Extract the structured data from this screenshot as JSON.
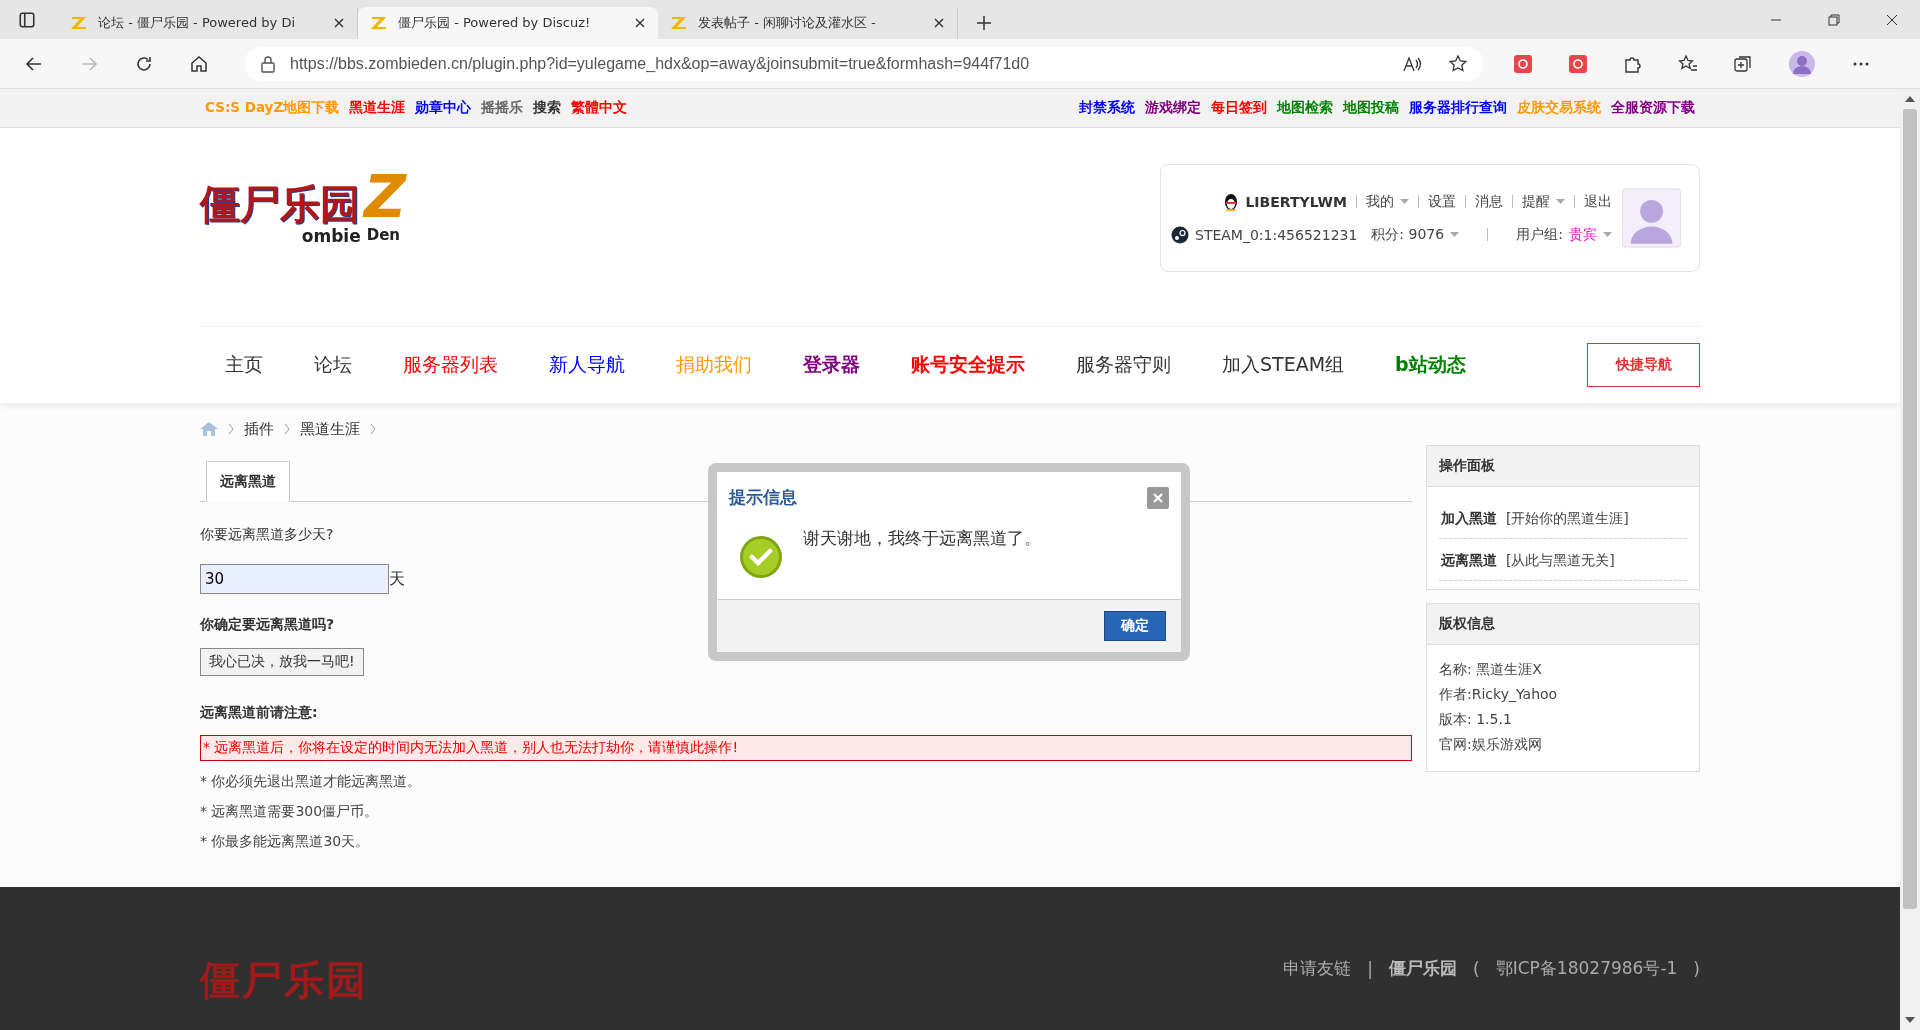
{
  "browser": {
    "tabs": [
      {
        "title": "论坛 - 僵尸乐园 - Powered by Di",
        "selected": false
      },
      {
        "title": "僵尸乐园 - Powered by Discuz!",
        "selected": true
      },
      {
        "title": "发表帖子 - 闲聊讨论及灌水区 -",
        "selected": false
      }
    ],
    "url": "https://bbs.zombieden.cn/plugin.php?id=yulegame_hdx&op=away&joinsubmit=true&formhash=944f71d0"
  },
  "top_links_left": [
    {
      "label": "CS:S DayZ地图下载",
      "color": "#ff9900"
    },
    {
      "label": "黑道生涯",
      "color": "#ff0000"
    },
    {
      "label": "勋章中心",
      "color": "#0000ff"
    },
    {
      "label": "摇摇乐",
      "color": "#666666"
    },
    {
      "label": "搜索",
      "color": "#333333"
    },
    {
      "label": "繁體中文",
      "color": "#ff0000"
    }
  ],
  "top_links_right": [
    {
      "label": "封禁系统",
      "color": "#0000ff"
    },
    {
      "label": "游戏绑定",
      "color": "#800080"
    },
    {
      "label": "每日签到",
      "color": "#ff0000"
    },
    {
      "label": "地图检索",
      "color": "#008000"
    },
    {
      "label": "地图投稿",
      "color": "#008000"
    },
    {
      "label": "服务器排行查询",
      "color": "#0000ff"
    },
    {
      "label": "皮肤交易系统",
      "color": "#ff9900"
    },
    {
      "label": "全服资源下载",
      "color": "#800080"
    }
  ],
  "logo": {
    "title": "僵尸乐园",
    "mark": "Z",
    "line_1": "ombie",
    "line_2": "Den"
  },
  "user": {
    "name": "LIBERTYLWM",
    "links": [
      {
        "label": "我的",
        "menu": true
      },
      {
        "label": "设置",
        "menu": false
      },
      {
        "label": "消息",
        "menu": false
      },
      {
        "label": "提醒",
        "menu": true
      },
      {
        "label": "退出",
        "menu": false
      }
    ],
    "steam_id": "STEAM_0:1:456521231",
    "points": "积分: 9076",
    "group_label": "用户组:",
    "group": "贵宾"
  },
  "nav": [
    {
      "label": "主页",
      "color": "#333333",
      "bold": false
    },
    {
      "label": "论坛",
      "color": "#333333",
      "bold": false
    },
    {
      "label": "服务器列表",
      "color": "#ff0000",
      "bold": false
    },
    {
      "label": "新人导航",
      "color": "#0000ff",
      "bold": false
    },
    {
      "label": "捐助我们",
      "color": "#ff9900",
      "bold": false
    },
    {
      "label": "登录器",
      "color": "#800080",
      "bold": true
    },
    {
      "label": "账号安全提示",
      "color": "#ff0000",
      "bold": true
    },
    {
      "label": "服务器守则",
      "color": "#333333",
      "bold": false
    },
    {
      "label": "加入STEAM组",
      "color": "#333333",
      "bold": false
    },
    {
      "label": "b站动态",
      "color": "#008000",
      "bold": true
    }
  ],
  "quick_nav": "快捷导航",
  "breadcrumb": [
    "插件",
    "黑道生涯"
  ],
  "content_tabs": [
    {
      "label": "远离黑道",
      "selected": true
    }
  ],
  "form": {
    "question": "你要远离黑道多少天?",
    "days": "30",
    "unit": "天",
    "confirm_question": "你确定要远离黑道吗?",
    "submit": "我心已决，放我一马吧!",
    "notice_title": "远离黑道前请注意:",
    "warning": "* 远离黑道后，你将在设定的时间内无法加入黑道，别人也无法打劫你，请谨慎此操作!",
    "notes": [
      "* 你必须先退出黑道才能远离黑道。",
      "* 远离黑道需要300僵尸币。",
      "* 你最多能远离黑道30天。"
    ]
  },
  "dialog": {
    "title": "提示信息",
    "message": "谢天谢地，我终于远离黑道了。",
    "ok": "确定"
  },
  "sidebar": [
    {
      "kind": "links",
      "title": "操作面板",
      "items": [
        {
          "label": "加入黑道",
          "desc": "[开始你的黑道生涯]"
        },
        {
          "label": "远离黑道",
          "desc": "[从此与黑道无关]"
        }
      ]
    },
    {
      "kind": "info",
      "title": "版权信息",
      "lines": [
        "名称: 黑道生涯X",
        "作者:Ricky_Yahoo",
        "版本: 1.5.1",
        "官网:娱乐游戏网"
      ]
    }
  ],
  "footer": {
    "logo": "僵尸乐园",
    "links": [
      "申请友链",
      "|",
      "僵尸乐园",
      "(",
      "鄂ICP备18027986号-1",
      ")"
    ]
  }
}
